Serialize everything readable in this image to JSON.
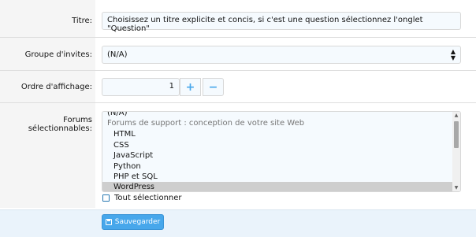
{
  "form": {
    "title": {
      "label": "Titre:",
      "value": "Choisissez un titre explicite et concis, si c'est une question sélectionnez l'onglet \"Question\""
    },
    "guest_group": {
      "label": "Groupe d'invites:",
      "selected": "(N/A)"
    },
    "display_order": {
      "label": "Ordre d'affichage:",
      "value": "1",
      "plus": "+",
      "minus": "−"
    },
    "forums": {
      "label": "Forums sélectionnables:",
      "options": [
        {
          "text": "(N/A)",
          "kind": "none"
        },
        {
          "text": "Forums de support : conception de votre site Web",
          "kind": "group"
        },
        {
          "text": "HTML",
          "kind": "child"
        },
        {
          "text": "CSS",
          "kind": "child"
        },
        {
          "text": "JavaScript",
          "kind": "child"
        },
        {
          "text": "Python",
          "kind": "child"
        },
        {
          "text": "PHP et SQL",
          "kind": "child"
        },
        {
          "text": "WordPress",
          "kind": "child",
          "selected": true
        }
      ],
      "select_all": "Tout sélectionner"
    }
  },
  "footer": {
    "save_label": "Sauvegarder"
  },
  "icons": {
    "select_arrow": "sort-arrows-icon",
    "save": "save-icon"
  },
  "colors": {
    "accent": "#47a7eb",
    "footer_bg": "#eaf3fb",
    "input_bg": "#f5fafe"
  }
}
